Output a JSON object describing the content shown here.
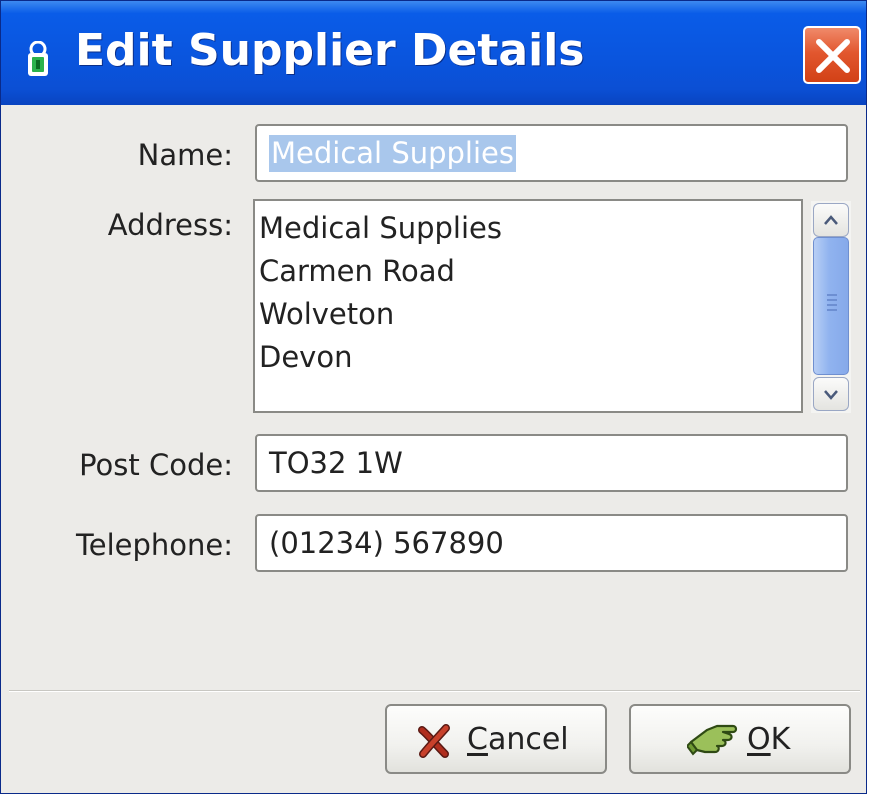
{
  "window": {
    "title": "Edit Supplier Details",
    "colors": {
      "titlebar": "#0a55de",
      "close_button": "#e2572f",
      "dialog_background": "#ecebe8",
      "selection": "#a9c7ec"
    }
  },
  "form": {
    "name_label": "Name:",
    "name_value": "Medical Supplies",
    "address_label": "Address:",
    "address_lines": [
      "Medical Supplies",
      "Carmen Road",
      "Wolveton",
      "Devon"
    ],
    "post_code_label": "Post Code:",
    "post_code_value": "TO32 1W",
    "telephone_label": "Telephone:",
    "telephone_value": "(01234) 567890"
  },
  "buttons": {
    "cancel": {
      "label": "Cancel",
      "mnemonic": "C",
      "icon": "cancel-x-icon"
    },
    "ok": {
      "label": "OK",
      "mnemonic": "O",
      "icon": "ok-hand-icon"
    }
  },
  "icons": {
    "title": "lock-icon",
    "close": "close-icon",
    "scroll_up": "chevron-up-icon",
    "scroll_down": "chevron-down-icon"
  }
}
